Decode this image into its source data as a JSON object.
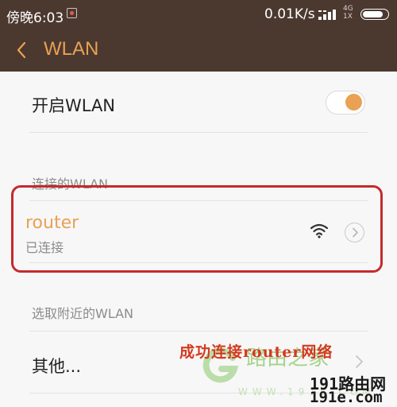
{
  "status_bar": {
    "time": "傍晚6:03",
    "net_speed": "0.01K/s",
    "net_type_top": "4G",
    "net_type_bottom": "1X",
    "battery_level": 0.85
  },
  "action_bar": {
    "title": "WLAN",
    "back_icon": "chevron-left-icon"
  },
  "wlan_toggle": {
    "label": "开启WLAN",
    "enabled": true
  },
  "connected_section": {
    "title": "连接的WLAN",
    "network": {
      "name": "router",
      "status": "已连接",
      "signal_icon": "wifi-icon",
      "detail_icon": "chevron-right-circle-icon"
    }
  },
  "nearby_section": {
    "title": "选取附近的WLAN",
    "items": [
      {
        "label": "其他..."
      }
    ]
  },
  "annotation": {
    "text": "成功连接router网络",
    "color": "#d33a1e"
  },
  "watermark": {
    "brand": "路由之家",
    "subtitle": "WWW.191E.COM",
    "site_line1": "191路由网",
    "site_line2": "191e.com"
  },
  "colors": {
    "header_bg": "#4b3930",
    "accent": "#e9a153",
    "highlight": "#c42a2e"
  }
}
